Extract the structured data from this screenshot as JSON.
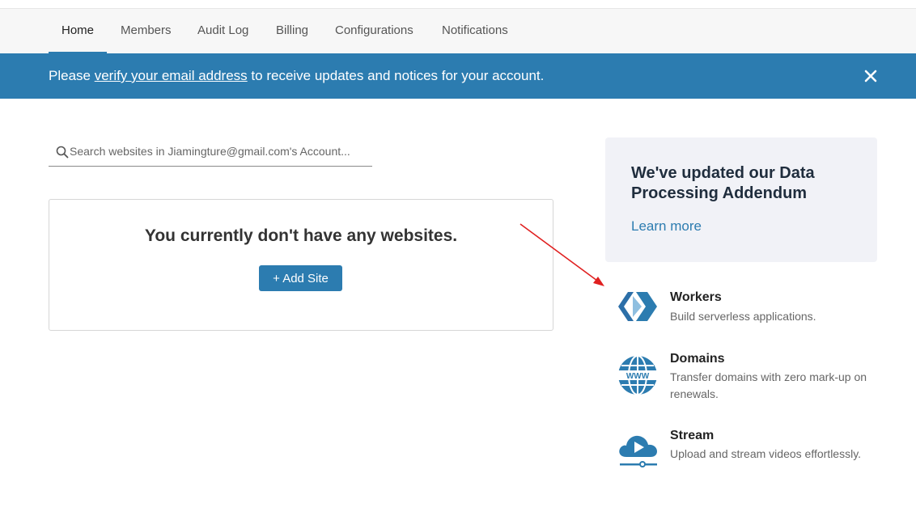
{
  "nav": {
    "tabs": [
      {
        "label": "Home",
        "active": true
      },
      {
        "label": "Members",
        "active": false
      },
      {
        "label": "Audit Log",
        "active": false
      },
      {
        "label": "Billing",
        "active": false
      },
      {
        "label": "Configurations",
        "active": false
      },
      {
        "label": "Notifications",
        "active": false
      }
    ]
  },
  "banner": {
    "prefix": "Please",
    "link": "verify your email address",
    "suffix": "to receive updates and notices for your account.",
    "close_icon": "close-icon"
  },
  "search": {
    "placeholder": "Search websites in Jiamingture@gmail.com's Account...",
    "value": "",
    "icon": "search-icon"
  },
  "empty_state": {
    "title": "You currently don't have any websites.",
    "add_button": "+ Add Site"
  },
  "promo": {
    "title": "We've updated our Data Processing Addendum",
    "link": "Learn more"
  },
  "products": [
    {
      "name": "Workers",
      "description": "Build serverless applications.",
      "icon": "workers-icon"
    },
    {
      "name": "Domains",
      "description": "Transfer domains with zero mark-up on renewals.",
      "icon": "globe-www-icon"
    },
    {
      "name": "Stream",
      "description": "Upload and stream videos effortlessly.",
      "icon": "cloud-play-icon"
    }
  ],
  "colors": {
    "accent": "#2c7cb0",
    "banner_bg": "#2c7cb0",
    "promo_bg": "#f1f2f7",
    "annotation_arrow": "#e02020"
  }
}
